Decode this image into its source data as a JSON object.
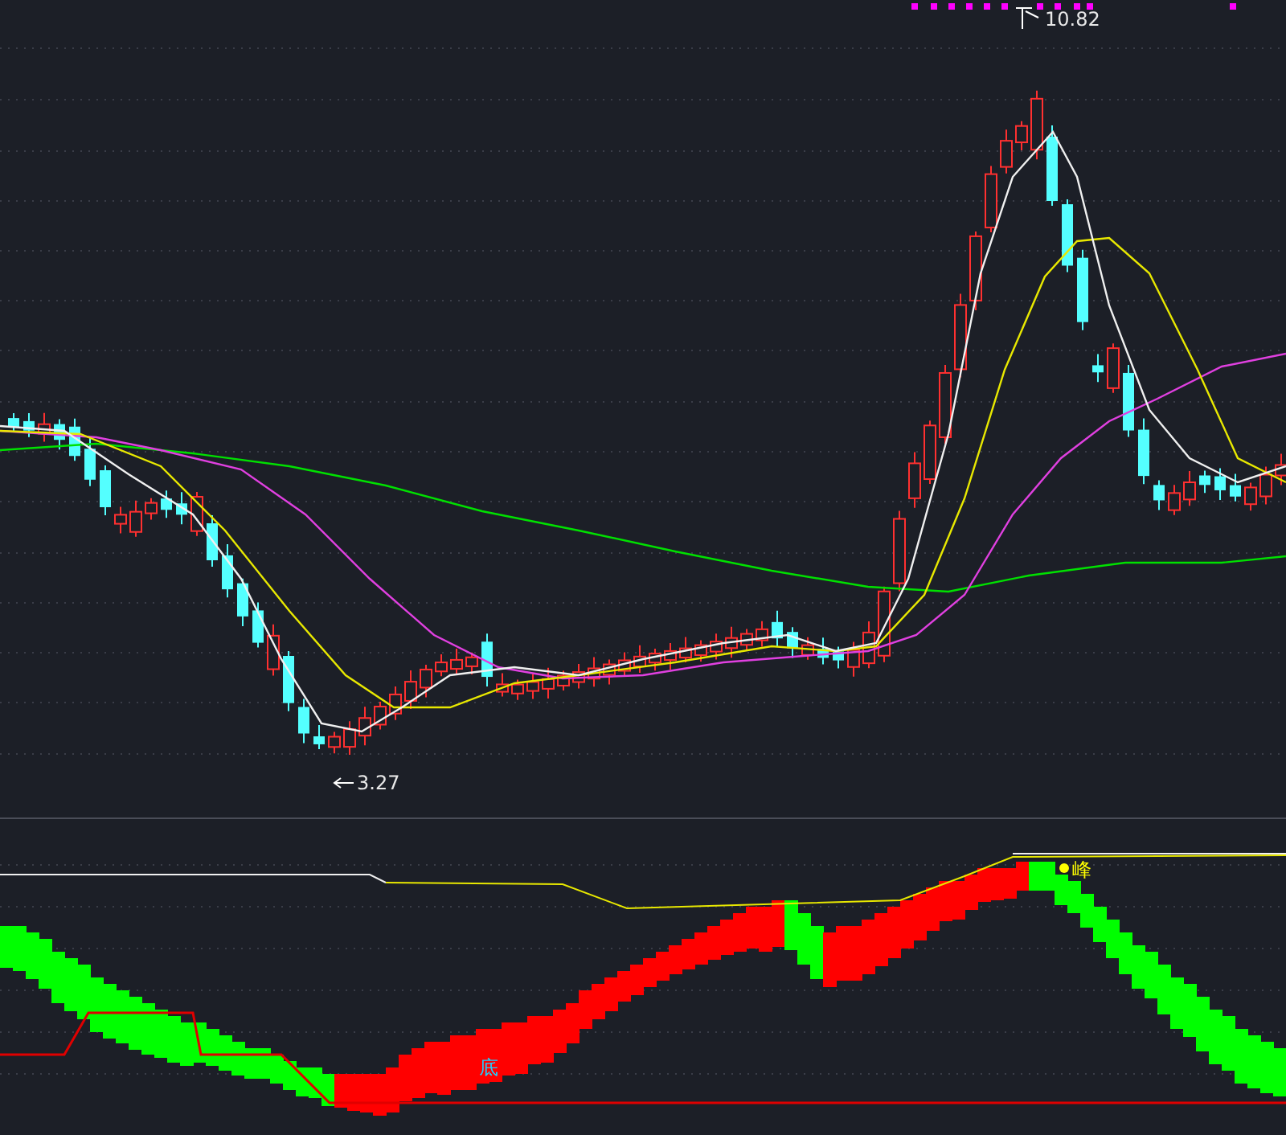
{
  "price_chart": {
    "high_label": "10.82",
    "low_label": "3.27"
  },
  "indicator_chart": {
    "peak_label": "峰",
    "bottom_label": "底"
  }
}
